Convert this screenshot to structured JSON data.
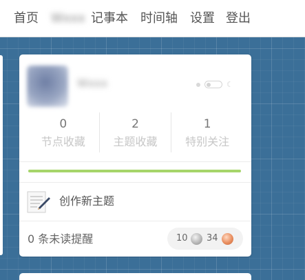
{
  "nav": {
    "items": [
      "首页",
      "Wxxx",
      "记事本",
      "时间轴",
      "设置",
      "登出"
    ]
  },
  "profile": {
    "username": "Wxxx"
  },
  "stats": [
    {
      "value": "0",
      "label": "节点收藏"
    },
    {
      "value": "2",
      "label": "主题收藏"
    },
    {
      "value": "1",
      "label": "特别关注"
    }
  ],
  "progress_fraction": 1.0,
  "actions": {
    "create_topic": "创作新主题"
  },
  "notifications": {
    "text": "0 条未读提醒"
  },
  "balance": {
    "silver": "10",
    "bronze": "34"
  },
  "icons": {
    "theme_sun": "sun-icon",
    "theme_moon": "moon-icon",
    "create": "notepad-pencil-icon",
    "silver_coin": "silver-coin-icon",
    "bronze_coin": "bronze-coin-icon"
  },
  "colors": {
    "background": "#3b6f98",
    "progress": "#a6d56a",
    "silver": "#b8b8b8",
    "bronze": "#e98e5f"
  }
}
